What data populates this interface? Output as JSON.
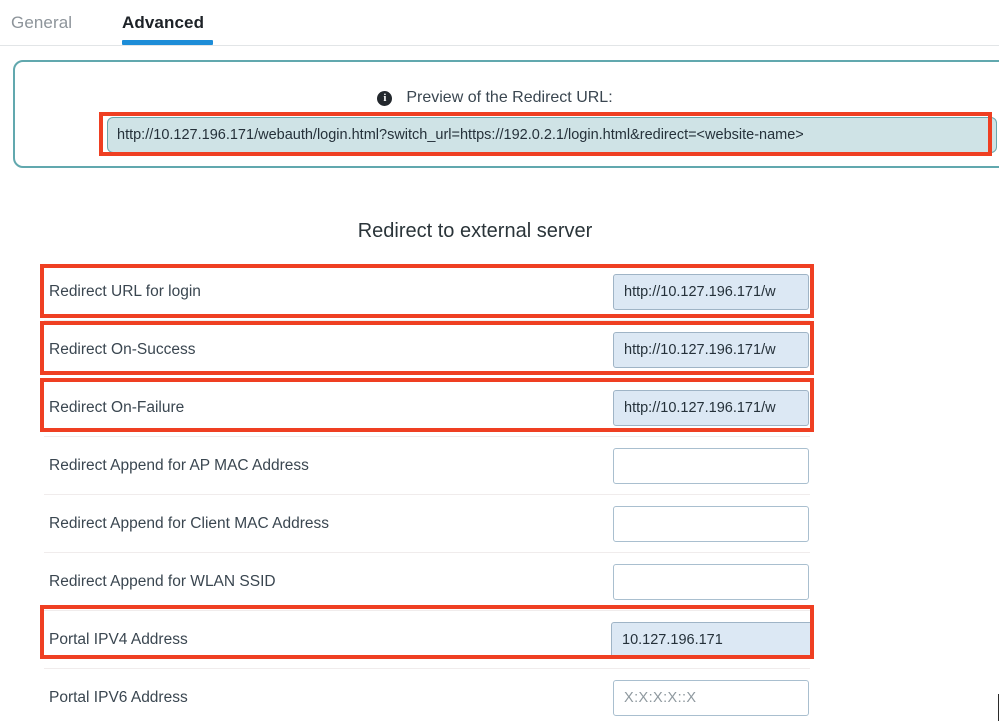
{
  "tabs": [
    {
      "label": "General",
      "active": false
    },
    {
      "label": "Advanced",
      "active": true
    }
  ],
  "preview": {
    "info_icon": "info-icon",
    "label": "Preview of the Redirect URL:",
    "url": "http://10.127.196.171/webauth/login.html?switch_url=https://192.0.2.1/login.html&redirect=<website-name>"
  },
  "section": {
    "title": "Redirect to external server"
  },
  "fields": [
    {
      "label": "Redirect URL for login",
      "value": "http://10.127.196.171/w",
      "placeholder": "",
      "filled": true,
      "highlighted": true
    },
    {
      "label": "Redirect On-Success",
      "value": "http://10.127.196.171/w",
      "placeholder": "",
      "filled": true,
      "highlighted": true
    },
    {
      "label": "Redirect On-Failure",
      "value": "http://10.127.196.171/w",
      "placeholder": "",
      "filled": true,
      "highlighted": true
    },
    {
      "label": "Redirect Append for AP MAC Address",
      "value": "",
      "placeholder": "",
      "filled": false,
      "highlighted": false
    },
    {
      "label": "Redirect Append for Client MAC Address",
      "value": "",
      "placeholder": "",
      "filled": false,
      "highlighted": false
    },
    {
      "label": "Redirect Append for WLAN SSID",
      "value": "",
      "placeholder": "",
      "filled": false,
      "highlighted": false
    },
    {
      "label": "Portal IPV4 Address",
      "value": "10.127.196.171",
      "placeholder": "",
      "filled": true,
      "highlighted": true
    },
    {
      "label": "Portal IPV6 Address",
      "value": "",
      "placeholder": "X:X:X:X::X",
      "filled": false,
      "highlighted": false
    }
  ],
  "colors": {
    "accent_tab": "#1d8dd8",
    "panel_border": "#61a8ae",
    "preview_fill": "#cfe3e6",
    "highlight": "#ef3f22",
    "field_fill": "#dce8f4",
    "field_border": "#a9bfcf"
  }
}
